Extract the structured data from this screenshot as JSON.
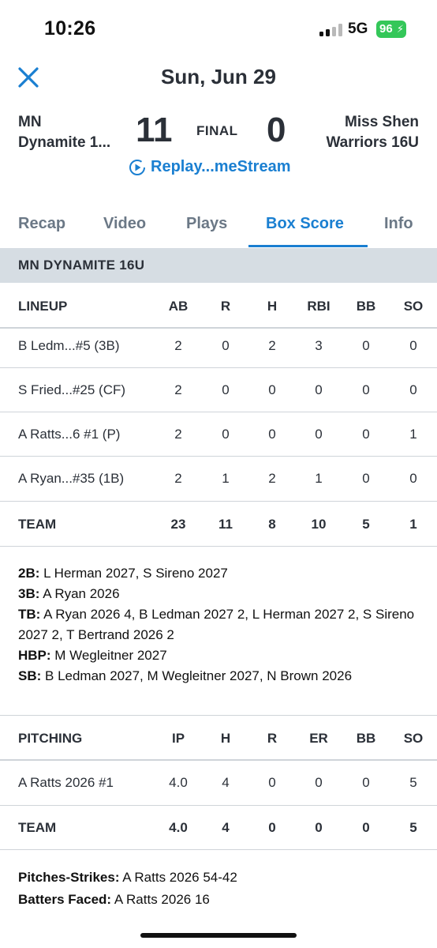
{
  "status": {
    "time": "10:26",
    "network": "5G",
    "battery": "96"
  },
  "header": {
    "title": "Sun, Jun 29"
  },
  "game": {
    "home_name_1": "MN",
    "home_name_2": "Dynamite 1...",
    "home_score": "11",
    "status": "FINAL",
    "away_score": "0",
    "away_name_1": "Miss Shen",
    "away_name_2": "Warriors 16U",
    "replay": "Replay...meStream"
  },
  "tabs": [
    "Recap",
    "Video",
    "Plays",
    "Box Score",
    "Info"
  ],
  "team_header": "MN DYNAMITE 16U",
  "lineup": {
    "headers": [
      "LINEUP",
      "AB",
      "R",
      "H",
      "RBI",
      "BB",
      "SO"
    ],
    "rows": [
      [
        "B Ledm...#5 (3B)",
        "2",
        "0",
        "2",
        "3",
        "0",
        "0"
      ],
      [
        "S Fried...#25 (CF)",
        "2",
        "0",
        "0",
        "0",
        "0",
        "0"
      ],
      [
        "A Ratts...6 #1 (P)",
        "2",
        "0",
        "0",
        "0",
        "0",
        "1"
      ],
      [
        "A Ryan...#35 (1B)",
        "2",
        "1",
        "2",
        "1",
        "0",
        "0"
      ]
    ],
    "total": [
      "TEAM",
      "23",
      "11",
      "8",
      "10",
      "5",
      "1"
    ]
  },
  "batting_notes": [
    {
      "label": "2B:",
      "text": " L Herman 2027, S Sireno 2027"
    },
    {
      "label": "3B:",
      "text": " A Ryan 2026"
    },
    {
      "label": "TB:",
      "text": " A Ryan 2026 4, B Ledman 2027 2, L Herman 2027 2, S Sireno 2027 2, T Bertrand 2026 2"
    },
    {
      "label": "HBP:",
      "text": " M Wegleitner 2027"
    },
    {
      "label": "SB:",
      "text": " B Ledman 2027, M Wegleitner 2027, N Brown 2026"
    }
  ],
  "pitching": {
    "headers": [
      "PITCHING",
      "IP",
      "H",
      "R",
      "ER",
      "BB",
      "SO"
    ],
    "rows": [
      [
        "A Ratts 2026 #1",
        "4.0",
        "4",
        "0",
        "0",
        "0",
        "5"
      ]
    ],
    "total": [
      "TEAM",
      "4.0",
      "4",
      "0",
      "0",
      "0",
      "5"
    ]
  },
  "pitching_notes": [
    {
      "label": "Pitches-Strikes:",
      "text": " A Ratts 2026 54-42"
    },
    {
      "label": "Batters Faced:",
      "text": " A Ratts 2026 16"
    }
  ],
  "colors": {
    "accent": "#1a7fd1",
    "section_bg": "#d6dde3",
    "battery": "#34c759"
  }
}
